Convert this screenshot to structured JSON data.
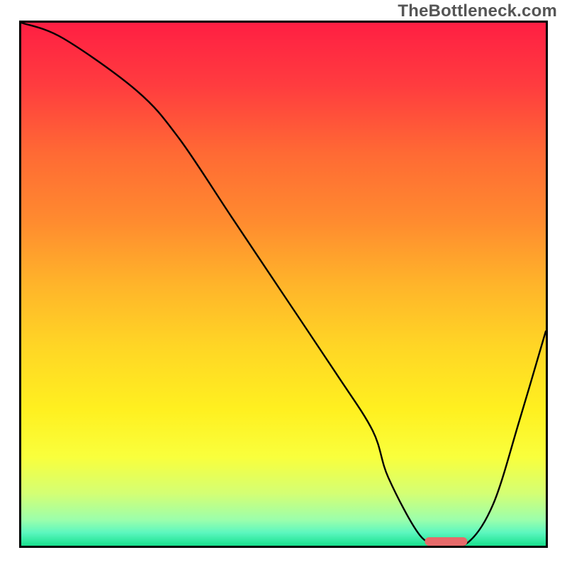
{
  "watermark": "TheBottleneck.com",
  "chart_data": {
    "type": "line",
    "title": "",
    "xlabel": "",
    "ylabel": "",
    "xlim": [
      0,
      100
    ],
    "ylim": [
      0,
      100
    ],
    "grid": false,
    "series": [
      {
        "name": "curve",
        "x": [
          0,
          8,
          22,
          30,
          40,
          50,
          60,
          67,
          70,
          76,
          80,
          85,
          90,
          95,
          100
        ],
        "values": [
          100,
          97,
          87,
          78,
          63,
          48,
          33,
          22,
          13,
          2,
          0.5,
          0.5,
          8,
          24,
          41
        ]
      }
    ],
    "marker": {
      "x_start": 77,
      "x_end": 85,
      "y": 0.8
    },
    "background_gradient": {
      "stops": [
        {
          "offset": 0.0,
          "color": "#ff1f43"
        },
        {
          "offset": 0.12,
          "color": "#ff3c3f"
        },
        {
          "offset": 0.25,
          "color": "#ff6a34"
        },
        {
          "offset": 0.38,
          "color": "#ff8b2f"
        },
        {
          "offset": 0.5,
          "color": "#ffb42a"
        },
        {
          "offset": 0.62,
          "color": "#ffd625"
        },
        {
          "offset": 0.74,
          "color": "#fff020"
        },
        {
          "offset": 0.83,
          "color": "#f9ff3c"
        },
        {
          "offset": 0.9,
          "color": "#d4ff74"
        },
        {
          "offset": 0.95,
          "color": "#9cffab"
        },
        {
          "offset": 0.975,
          "color": "#5cf7bf"
        },
        {
          "offset": 1.0,
          "color": "#18e08d"
        }
      ]
    }
  }
}
